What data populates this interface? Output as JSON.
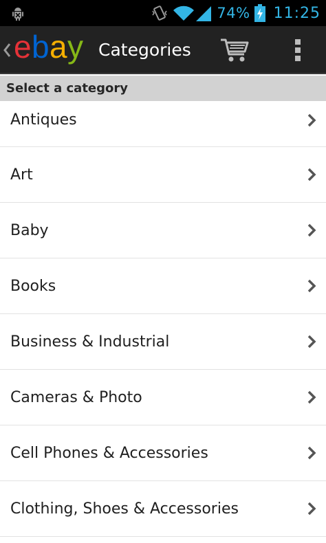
{
  "status_bar": {
    "battery_percent": "74%",
    "time": "11:25",
    "icons": [
      "android-debug-icon",
      "vibrate-icon",
      "wifi-icon",
      "cell-signal-icon",
      "battery-charging-icon"
    ]
  },
  "action_bar": {
    "title": "Categories",
    "logo_text": "ebay",
    "colors": {
      "background": "#222222",
      "logo_e": "#e53238",
      "logo_b": "#0064d2",
      "logo_a": "#f5af02",
      "logo_y": "#86b817"
    }
  },
  "section_header": "Select a category",
  "categories": [
    {
      "label": "Antiques"
    },
    {
      "label": "Art"
    },
    {
      "label": "Baby"
    },
    {
      "label": "Books"
    },
    {
      "label": "Business & Industrial"
    },
    {
      "label": "Cameras & Photo"
    },
    {
      "label": "Cell Phones & Accessories"
    },
    {
      "label": "Clothing, Shoes & Accessories"
    }
  ]
}
